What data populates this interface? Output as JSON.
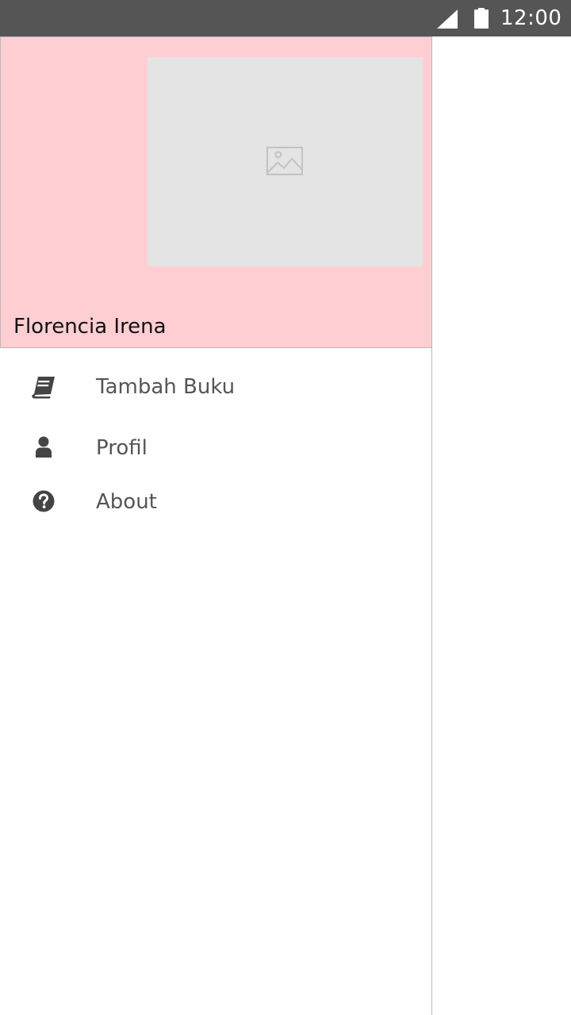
{
  "status_bar": {
    "time": "12:00",
    "icons": [
      "signal-icon",
      "battery-icon"
    ]
  },
  "drawer": {
    "header": {
      "user_name": "Florencia Irena",
      "background_color": "#ffced3",
      "image_icon": "image-placeholder-icon"
    },
    "menu": [
      {
        "icon": "book-icon",
        "label": "Tambah Buku"
      },
      {
        "icon": "user-icon",
        "label": "Profil"
      },
      {
        "icon": "question-circle-icon",
        "label": "About"
      }
    ]
  }
}
